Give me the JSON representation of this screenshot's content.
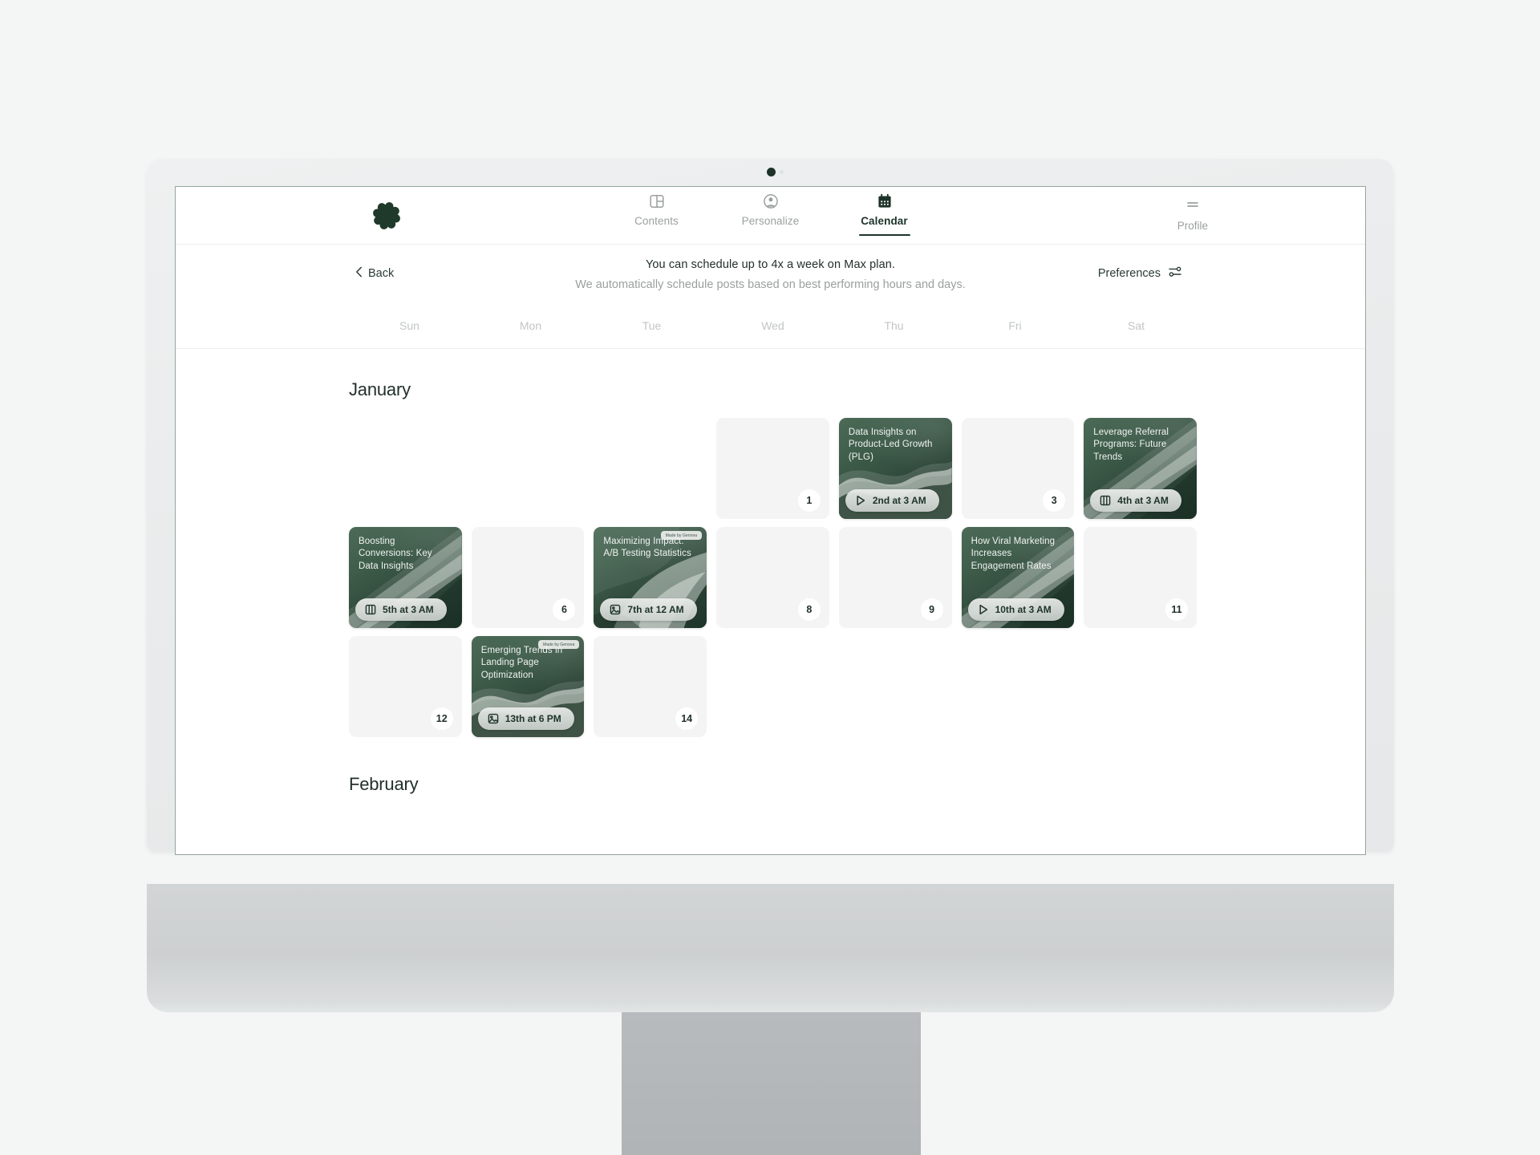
{
  "brand": {
    "logo_name": "swirl-logo",
    "accent_dark": "#1d3329",
    "accent_mid": "#3f5d4b",
    "page_bg": "#f4f5f5"
  },
  "nav": {
    "items": [
      {
        "label": "Contents",
        "icon": "layout-panel-icon",
        "active": false
      },
      {
        "label": "Personalize",
        "icon": "user-circle-icon",
        "active": false
      },
      {
        "label": "Calendar",
        "icon": "calendar-icon",
        "active": true
      }
    ],
    "profile": {
      "label": "Profile",
      "icon": "menu-lines-icon"
    }
  },
  "subheader": {
    "back_label": "Back",
    "back_icon": "chevron-left-icon",
    "line1": "You can schedule up to 4x a week on Max plan.",
    "line2": "We automatically schedule posts based on best performing hours and days.",
    "preferences_label": "Preferences",
    "preferences_icon": "sliders-icon"
  },
  "weekdays": [
    "Sun",
    "Mon",
    "Tue",
    "Wed",
    "Thu",
    "Fri",
    "Sat"
  ],
  "months": [
    {
      "name": "January"
    },
    {
      "name": "February"
    }
  ],
  "badge_text": "Made by Genova",
  "january_cells": [
    {
      "type": "blank"
    },
    {
      "type": "blank"
    },
    {
      "type": "blank"
    },
    {
      "type": "empty",
      "day": "1"
    },
    {
      "type": "scheduled",
      "day": "2",
      "title": "Data Insights on Product-Led Growth (PLG)",
      "time": "2nd at 3 AM",
      "media_icon": "play-icon",
      "badge": false,
      "art": "wave"
    },
    {
      "type": "empty",
      "day": "3"
    },
    {
      "type": "scheduled",
      "day": "4",
      "title": "Leverage Referral Programs: Future Trends",
      "time": "4th at 3 AM",
      "media_icon": "carousel-icon",
      "badge": false,
      "art": "diagonal"
    },
    {
      "type": "scheduled",
      "day": "5",
      "title": "Boosting Conversions: Key Data Insights",
      "time": "5th at 3 AM",
      "media_icon": "carousel-icon",
      "badge": false,
      "art": "diagonal"
    },
    {
      "type": "empty",
      "day": "6"
    },
    {
      "type": "scheduled",
      "day": "7",
      "title": "Maximizing Impact: A/B Testing Statistics",
      "time": "7th at 12 AM",
      "media_icon": "image-icon",
      "badge": true,
      "art": "leaf"
    },
    {
      "type": "empty",
      "day": "8"
    },
    {
      "type": "empty",
      "day": "9"
    },
    {
      "type": "scheduled",
      "day": "10",
      "title": "How Viral Marketing Increases Engagement Rates",
      "time": "10th at 3 AM",
      "media_icon": "play-icon",
      "badge": false,
      "art": "diagonal"
    },
    {
      "type": "empty",
      "day": "11"
    },
    {
      "type": "empty",
      "day": "12"
    },
    {
      "type": "scheduled",
      "day": "13",
      "title": "Emerging Trends in Landing Page Optimization",
      "time": "13th at 6 PM",
      "media_icon": "image-icon",
      "badge": true,
      "art": "wave"
    },
    {
      "type": "empty",
      "day": "14"
    }
  ]
}
